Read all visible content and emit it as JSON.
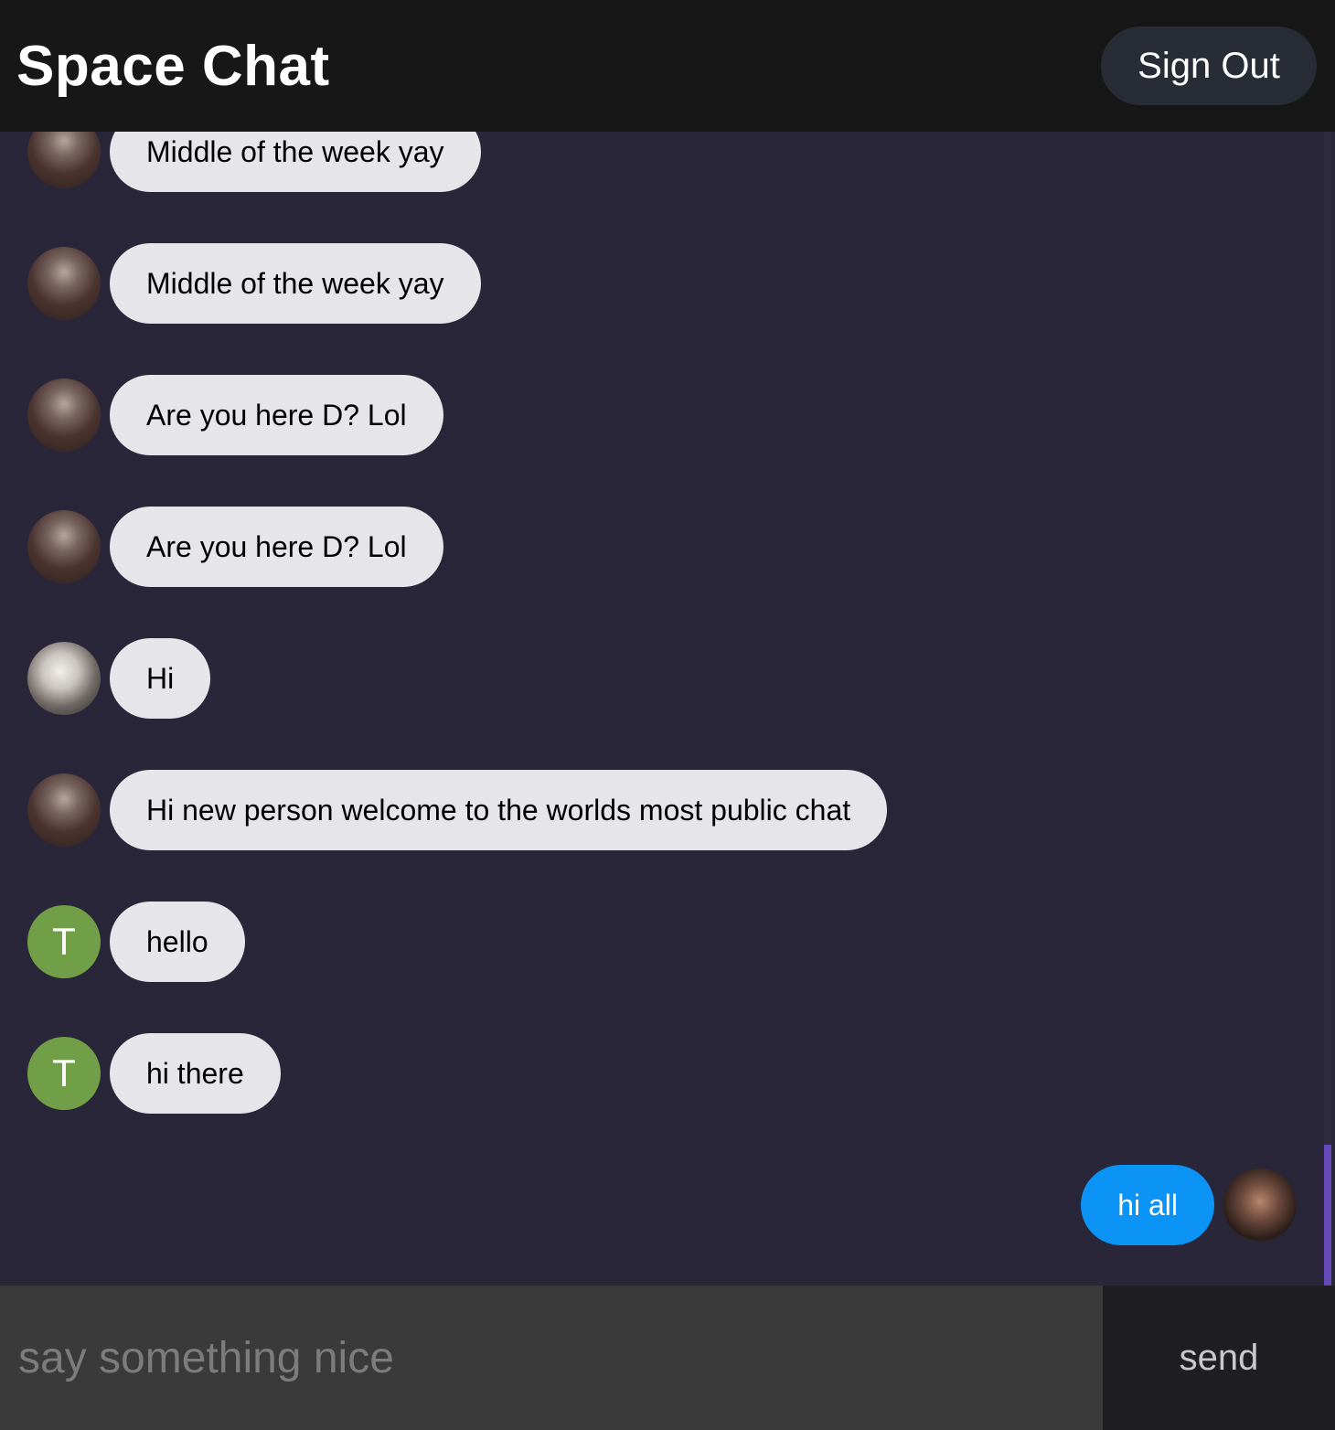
{
  "header": {
    "title": "Space Chat",
    "sign_out_label": "Sign Out"
  },
  "messages": [
    {
      "text": "Middle of the week yay",
      "direction": "received",
      "avatar": "photo-a"
    },
    {
      "text": "Middle of the week yay",
      "direction": "received",
      "avatar": "photo-a"
    },
    {
      "text": "Are you here D? Lol",
      "direction": "received",
      "avatar": "photo-a"
    },
    {
      "text": "Are you here D? Lol",
      "direction": "received",
      "avatar": "photo-a"
    },
    {
      "text": "Hi",
      "direction": "received",
      "avatar": "photo-b"
    },
    {
      "text": "Hi new person welcome to the worlds most public chat",
      "direction": "received",
      "avatar": "photo-a"
    },
    {
      "text": "hello",
      "direction": "received",
      "avatar": "letter",
      "avatar_letter": "T"
    },
    {
      "text": "hi there",
      "direction": "received",
      "avatar": "letter",
      "avatar_letter": "T"
    },
    {
      "text": "hi all",
      "direction": "sent",
      "avatar": "photo-c"
    }
  ],
  "composer": {
    "placeholder": "say something nice",
    "send_label": "send"
  },
  "colors": {
    "header_bg": "#181717",
    "chat_bg": "#282638",
    "received_bubble": "#e5e5ea",
    "sent_bubble": "#0b93f6",
    "letter_avatar": "#709f48",
    "scrollbar_thumb": "#6649b8"
  }
}
